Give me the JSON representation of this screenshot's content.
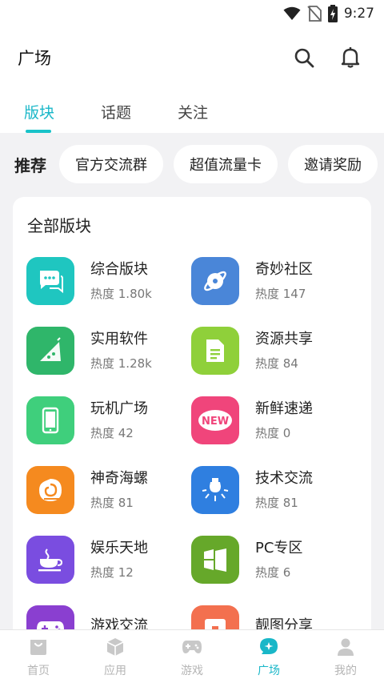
{
  "status_bar": {
    "time": "9:27"
  },
  "header": {
    "title": "广场"
  },
  "tabs": [
    {
      "label": "版块",
      "active": true
    },
    {
      "label": "话题",
      "active": false
    },
    {
      "label": "关注",
      "active": false
    }
  ],
  "recommend": {
    "label": "推荐",
    "chips": [
      "官方交流群",
      "超值流量卡",
      "邀请奖励"
    ]
  },
  "all_boards": {
    "title": "全部版块",
    "items": [
      {
        "name": "综合版块",
        "heat": "热度 1.80k",
        "icon": "chat-bubbles-icon",
        "color": "#1fc6c0"
      },
      {
        "name": "奇妙社区",
        "heat": "热度 147",
        "icon": "planet-icon",
        "color": "#4a86d8"
      },
      {
        "name": "实用软件",
        "heat": "热度 1.28k",
        "icon": "android-icon",
        "color": "#2fb66a"
      },
      {
        "name": "资源共享",
        "heat": "热度 84",
        "icon": "document-icon",
        "color": "#8fd03a"
      },
      {
        "name": "玩机广场",
        "heat": "热度 42",
        "icon": "phone-icon",
        "color": "#3fcf7c"
      },
      {
        "name": "新鲜速递",
        "heat": "热度 0",
        "icon": "new-badge-icon",
        "color": "#f0457b"
      },
      {
        "name": "神奇海螺",
        "heat": "热度 81",
        "icon": "conch-icon",
        "color": "#f58a1f"
      },
      {
        "name": "技术交流",
        "heat": "热度 81",
        "icon": "bulb-icon",
        "color": "#2f7fe0"
      },
      {
        "name": "娱乐天地",
        "heat": "热度 12",
        "icon": "coffee-icon",
        "color": "#7a4de0"
      },
      {
        "name": "PC专区",
        "heat": "热度 6",
        "icon": "windows-icon",
        "color": "#66a82a"
      },
      {
        "name": "游戏交流",
        "heat": "",
        "icon": "gamepad-icon",
        "color": "#8a3fd0"
      },
      {
        "name": "靓图分享",
        "heat": "",
        "icon": "image-icon",
        "color": "#f3704f"
      }
    ]
  },
  "bottom_nav": [
    {
      "label": "首页",
      "icon": "home-icon",
      "active": false
    },
    {
      "label": "应用",
      "icon": "box-icon",
      "active": false
    },
    {
      "label": "游戏",
      "icon": "gamepad-icon",
      "active": false
    },
    {
      "label": "广场",
      "icon": "square-icon",
      "active": true
    },
    {
      "label": "我的",
      "icon": "profile-icon",
      "active": false
    }
  ],
  "colors": {
    "accent": "#19b7c8",
    "background": "#f2f2f4"
  }
}
